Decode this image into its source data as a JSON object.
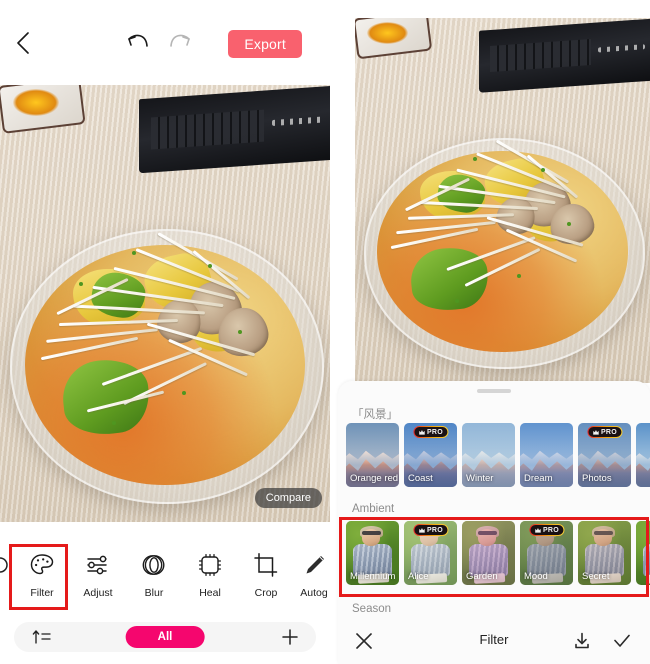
{
  "app": {
    "name": "photo-editor",
    "accent_pink": "#f5066e",
    "export_red": "#f9616e",
    "highlight_red": "#e51a1a"
  },
  "left_panel": {
    "topbar": {
      "back_icon": "chevron-left-icon",
      "undo_icon": "undo-arrow-icon",
      "redo_icon": "redo-arrow-icon",
      "export_label": "Export"
    },
    "canvas": {
      "compare_label": "Compare"
    },
    "tools": [
      {
        "label": "",
        "icon": "partial-tool-icon",
        "selected": false,
        "partial": true
      },
      {
        "label": "Filter",
        "icon": "palette-icon",
        "selected": true,
        "partial": false
      },
      {
        "label": "Adjust",
        "icon": "sliders-icon",
        "selected": false,
        "partial": false
      },
      {
        "label": "Blur",
        "icon": "blur-lens-icon",
        "selected": false,
        "partial": false
      },
      {
        "label": "Heal",
        "icon": "heal-patch-icon",
        "selected": false,
        "partial": false
      },
      {
        "label": "Crop",
        "icon": "crop-icon",
        "selected": false,
        "partial": false
      },
      {
        "label": "Autog",
        "icon": "autograph-pen-icon",
        "selected": false,
        "partial": true
      }
    ],
    "filter_bar": {
      "sort_icon": "sort-icon",
      "all_label": "All",
      "add_icon": "plus-icon"
    }
  },
  "right_panel": {
    "sheet": {
      "handle": "drag-handle",
      "sections": [
        {
          "title": "「风景」",
          "highlighted": false,
          "filters": [
            {
              "name": "Orange red",
              "pro": false,
              "kind": "landscape",
              "grade": "none"
            },
            {
              "name": "Coast",
              "pro": true,
              "kind": "landscape",
              "grade": "cool"
            },
            {
              "name": "Winter",
              "pro": false,
              "kind": "landscape",
              "grade": "pale"
            },
            {
              "name": "Dream",
              "pro": false,
              "kind": "landscape",
              "grade": "soft-blue"
            },
            {
              "name": "Photos",
              "pro": true,
              "kind": "landscape",
              "grade": "muted"
            },
            {
              "name": "",
              "pro": false,
              "kind": "landscape",
              "grade": "none",
              "partial": true
            }
          ]
        },
        {
          "title": "Ambient",
          "highlighted": true,
          "filters": [
            {
              "name": "Millennium",
              "pro": false,
              "kind": "portrait",
              "grade": "none"
            },
            {
              "name": "Alice",
              "pro": true,
              "kind": "portrait",
              "grade": "pale"
            },
            {
              "name": "Garden",
              "pro": false,
              "kind": "portrait",
              "grade": "magenta"
            },
            {
              "name": "Mood",
              "pro": true,
              "kind": "portrait",
              "grade": "grey"
            },
            {
              "name": "Secret",
              "pro": false,
              "kind": "portrait",
              "grade": "warm"
            },
            {
              "name": "",
              "pro": false,
              "kind": "portrait",
              "grade": "none",
              "partial": true
            }
          ]
        },
        {
          "title": "Season",
          "highlighted": false,
          "filters": []
        }
      ],
      "pro_badge_label": "PRO",
      "pro_badge_icon": "crown-icon",
      "bottom_bar": {
        "close_icon": "close-x-icon",
        "title": "Filter",
        "save_icon": "download-icon",
        "confirm_icon": "check-icon"
      }
    }
  }
}
